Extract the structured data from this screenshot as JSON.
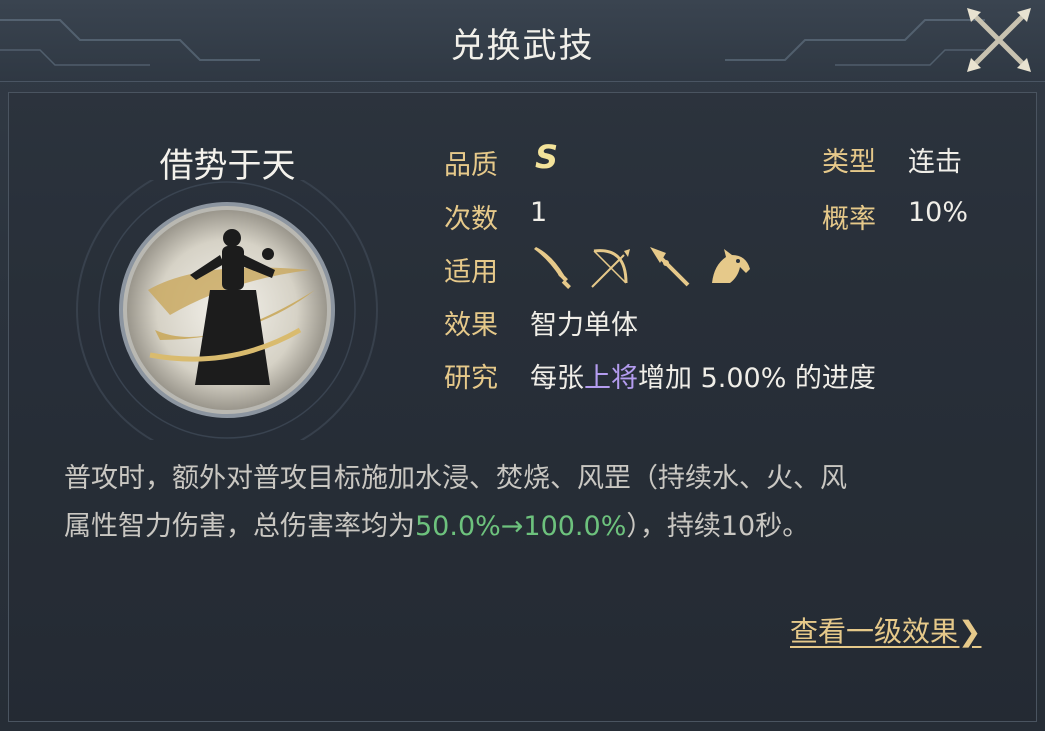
{
  "header": {
    "title": "兑换武技"
  },
  "skill": {
    "name": "借势于天",
    "quality_label": "品质",
    "quality_value": "S",
    "type_label": "类型",
    "type_value": "连击",
    "count_label": "次数",
    "count_value": "1",
    "rate_label": "概率",
    "rate_value": "10%",
    "applicable_label": "适用",
    "applicable_icons": [
      "sword-icon",
      "bow-icon",
      "spear-icon",
      "horse-icon"
    ],
    "effect_label": "效果",
    "effect_value": "智力单体",
    "research_label": "研究",
    "research_prefix": "每张",
    "research_highlight": "上将",
    "research_suffix": "增加 5.00% 的进度"
  },
  "description": {
    "line1": "普攻时，额外对普攻目标施加水浸、焚烧、风罡（持续水、火、风",
    "line2_prefix": "属性智力伤害，总伤害率均为",
    "line2_highlight": "50.0%→100.0%",
    "line2_suffix": "），持续10秒。"
  },
  "footer": {
    "link_text": "查看一级效果",
    "link_arrow": "❯"
  },
  "colors": {
    "label_gold": "#e6c98a",
    "highlight_purple": "#b49cf0",
    "highlight_green": "#6dc27d",
    "grade_yellow": "#f3e39a"
  }
}
